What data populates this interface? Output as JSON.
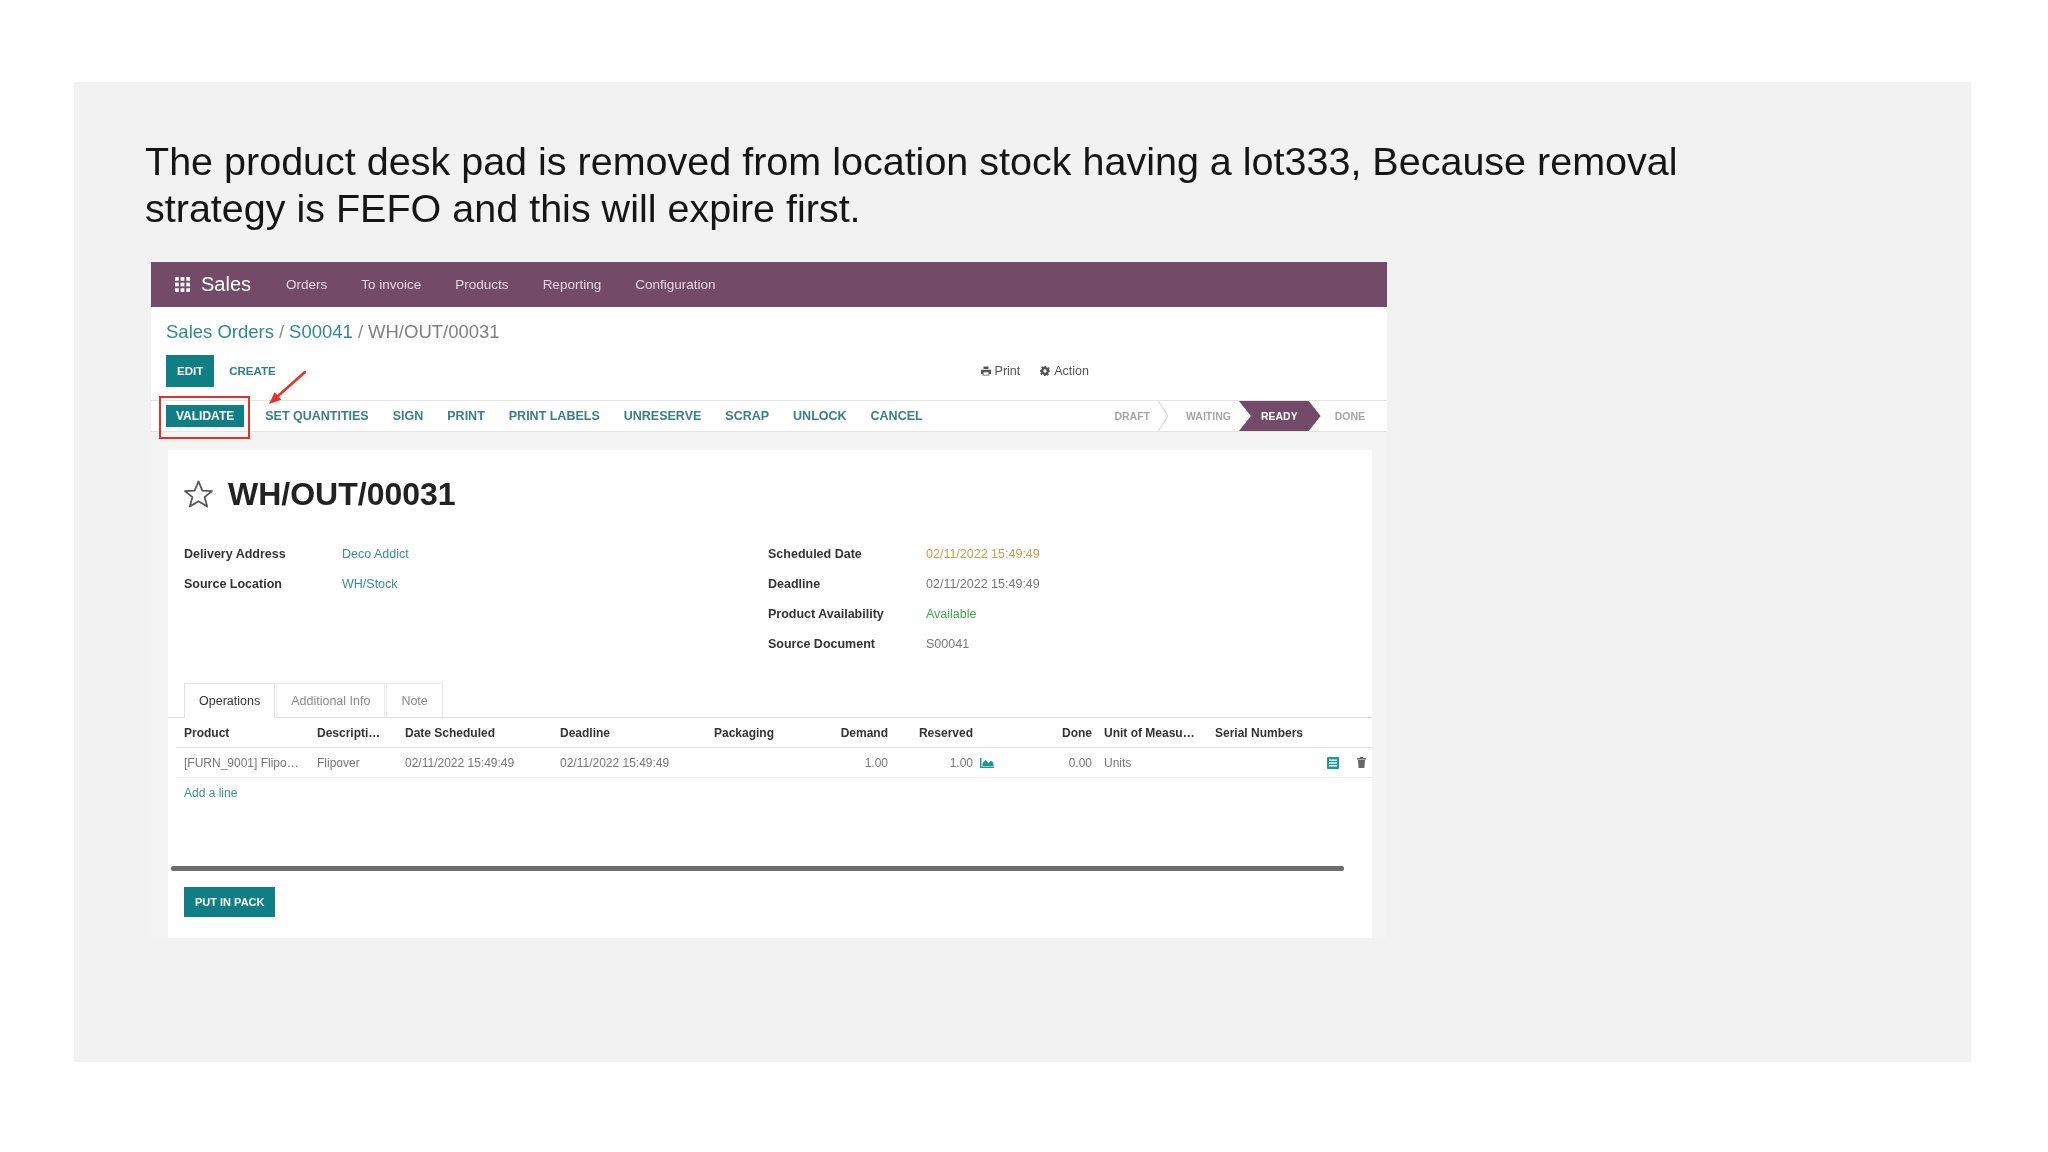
{
  "caption": "The product desk pad is removed from location stock having a lot333, Because removal strategy is FEFO and this will expire first.",
  "app": {
    "top_bar": {
      "app_name": "Sales",
      "menu": [
        "Orders",
        "To invoice",
        "Products",
        "Reporting",
        "Configuration"
      ]
    },
    "breadcrumb": {
      "separator": "/",
      "items": [
        {
          "label": "Sales Orders",
          "kind": "link"
        },
        {
          "label": "S00041",
          "kind": "link"
        },
        {
          "label": "WH/OUT/00031",
          "kind": "current"
        }
      ]
    },
    "buttons": [
      {
        "label": "EDIT",
        "kind": "primary"
      },
      {
        "label": "CREATE",
        "kind": "secondary"
      }
    ],
    "actions": [
      {
        "label": "Print",
        "kind": "print"
      },
      {
        "label": "Action",
        "kind": "action"
      }
    ],
    "status_buttons": [
      {
        "label": "VALIDATE",
        "kind": "primary",
        "highlighted": true
      },
      {
        "label": "SET QUANTITIES",
        "kind": "secondary",
        "highlighted": false
      },
      {
        "label": "SIGN",
        "kind": "secondary",
        "highlighted": false
      },
      {
        "label": "PRINT",
        "kind": "secondary",
        "highlighted": false
      },
      {
        "label": "PRINT LABELS",
        "kind": "secondary",
        "highlighted": false
      },
      {
        "label": "UNRESERVE",
        "kind": "secondary",
        "highlighted": false
      },
      {
        "label": "SCRAP",
        "kind": "secondary",
        "highlighted": false
      },
      {
        "label": "UNLOCK",
        "kind": "secondary",
        "highlighted": false
      },
      {
        "label": "CANCEL",
        "kind": "secondary",
        "highlighted": false
      }
    ],
    "stages": [
      {
        "label": "DRAFT",
        "selected": false
      },
      {
        "label": "WAITING",
        "selected": false
      },
      {
        "label": "READY",
        "selected": true
      },
      {
        "label": "DONE",
        "selected": false
      }
    ],
    "record": {
      "starred": false,
      "name": "WH/OUT/00031",
      "left_fields": [
        {
          "label": "Delivery Address",
          "value": "Deco Addict",
          "kind": "link"
        },
        {
          "label": "Source Location",
          "value": "WH/Stock",
          "kind": "link"
        }
      ],
      "right_fields": [
        {
          "label": "Scheduled Date",
          "value": "02/11/2022 15:49:49",
          "kind": "warning"
        },
        {
          "label": "Deadline",
          "value": "02/11/2022 15:49:49",
          "kind": "text"
        },
        {
          "label": "Product Availability",
          "value": "Available",
          "kind": "success"
        },
        {
          "label": "Source Document",
          "value": "S00041",
          "kind": "text"
        }
      ]
    },
    "tabs": [
      {
        "label": "Operations",
        "selected": true
      },
      {
        "label": "Additional Info",
        "selected": false
      },
      {
        "label": "Note",
        "selected": false
      }
    ],
    "table": {
      "columns": [
        {
          "label": "Product",
          "kind": "text"
        },
        {
          "label": "Descripti…",
          "kind": "text"
        },
        {
          "label": "Date Scheduled",
          "kind": "text"
        },
        {
          "label": "Deadline",
          "kind": "text"
        },
        {
          "label": "Packaging",
          "kind": "text"
        },
        {
          "label": "Demand",
          "kind": "number"
        },
        {
          "label": "Reserved",
          "kind": "forecast"
        },
        {
          "label": "Done",
          "kind": "number"
        },
        {
          "label": "Unit of Measu…",
          "kind": "text"
        },
        {
          "label": "Serial Numbers",
          "kind": "text"
        }
      ],
      "rows": [
        [
          "[FURN_9001] Flipo…",
          "Flipover",
          "02/11/2022 15:49:49",
          "02/11/2022 15:49:49",
          null,
          "1.00",
          "1.00",
          "0.00",
          "Units",
          null
        ]
      ],
      "add_line": "Add a line"
    },
    "footer_buttons": [
      "PUT IN PACK"
    ]
  }
}
